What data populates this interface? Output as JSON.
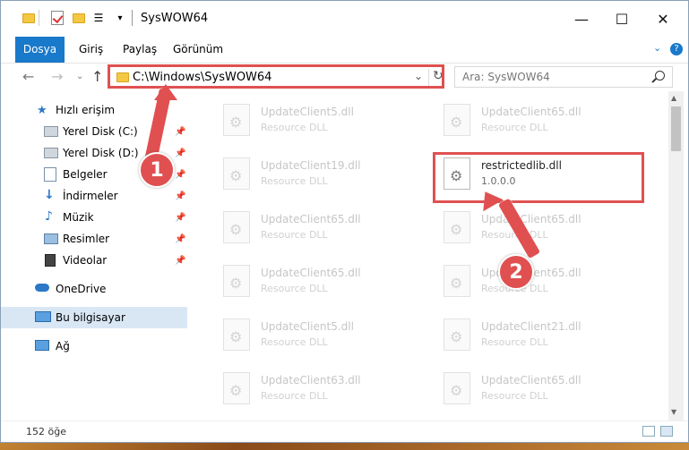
{
  "window": {
    "title": "SysWOW64",
    "controls": {
      "minimize": "—",
      "maximize": "☐",
      "close": "✕"
    }
  },
  "ribbon": {
    "tabs": [
      "Dosya",
      "Giriş",
      "Paylaş",
      "Görünüm"
    ],
    "expand": "⌄",
    "help": "?"
  },
  "address": {
    "path": "C:\\Windows\\SysWOW64",
    "search_placeholder": "Ara: SysWOW64"
  },
  "nav": {
    "items": [
      {
        "label": "Hızlı erişim",
        "icon": "star-icon",
        "pinned": false
      },
      {
        "label": "Yerel Disk (C:)",
        "icon": "drive-icon",
        "pinned": true
      },
      {
        "label": "Yerel Disk (D:)",
        "icon": "drive-icon",
        "pinned": true
      },
      {
        "label": "Belgeler",
        "icon": "documents-icon",
        "pinned": true
      },
      {
        "label": "İndirmeler",
        "icon": "downloads-icon",
        "pinned": true
      },
      {
        "label": "Müzik",
        "icon": "music-icon",
        "pinned": true
      },
      {
        "label": "Resimler",
        "icon": "pictures-icon",
        "pinned": true
      },
      {
        "label": "Videolar",
        "icon": "videos-icon",
        "pinned": true
      },
      {
        "label": "OneDrive",
        "icon": "cloud-icon",
        "pinned": false
      },
      {
        "label": "Bu bilgisayar",
        "icon": "computer-icon",
        "pinned": false
      },
      {
        "label": "Ağ",
        "icon": "network-icon",
        "pinned": false
      }
    ]
  },
  "files": [
    {
      "name": "UpdateClient5.dll",
      "sub": "Resource DLL"
    },
    {
      "name": "UpdateClient65.dll",
      "sub": "Resource DLL"
    },
    {
      "name": "UpdateClient19.dll",
      "sub": "Resource DLL"
    },
    {
      "name": "restrictedlib.dll",
      "sub": "1.0.0.0"
    },
    {
      "name": "UpdateClient65.dll",
      "sub": "Resource DLL"
    },
    {
      "name": "UpdateClient65.dll",
      "sub": "Resource DLL"
    },
    {
      "name": "UpdateClient65.dll",
      "sub": "Resource DLL"
    },
    {
      "name": "UpdateClient65.dll",
      "sub": "Resource DLL"
    },
    {
      "name": "UpdateClient5.dll",
      "sub": "Resource DLL"
    },
    {
      "name": "UpdateClient21.dll",
      "sub": "Resource DLL"
    },
    {
      "name": "UpdateClient63.dll",
      "sub": "Resource DLL"
    },
    {
      "name": "UpdateClient65.dll",
      "sub": "Resource DLL"
    }
  ],
  "status": {
    "count": "152 öğe"
  },
  "annotations": {
    "step1": "1",
    "step2": "2"
  },
  "colors": {
    "accent": "#1979ca",
    "highlight": "#e05050"
  }
}
